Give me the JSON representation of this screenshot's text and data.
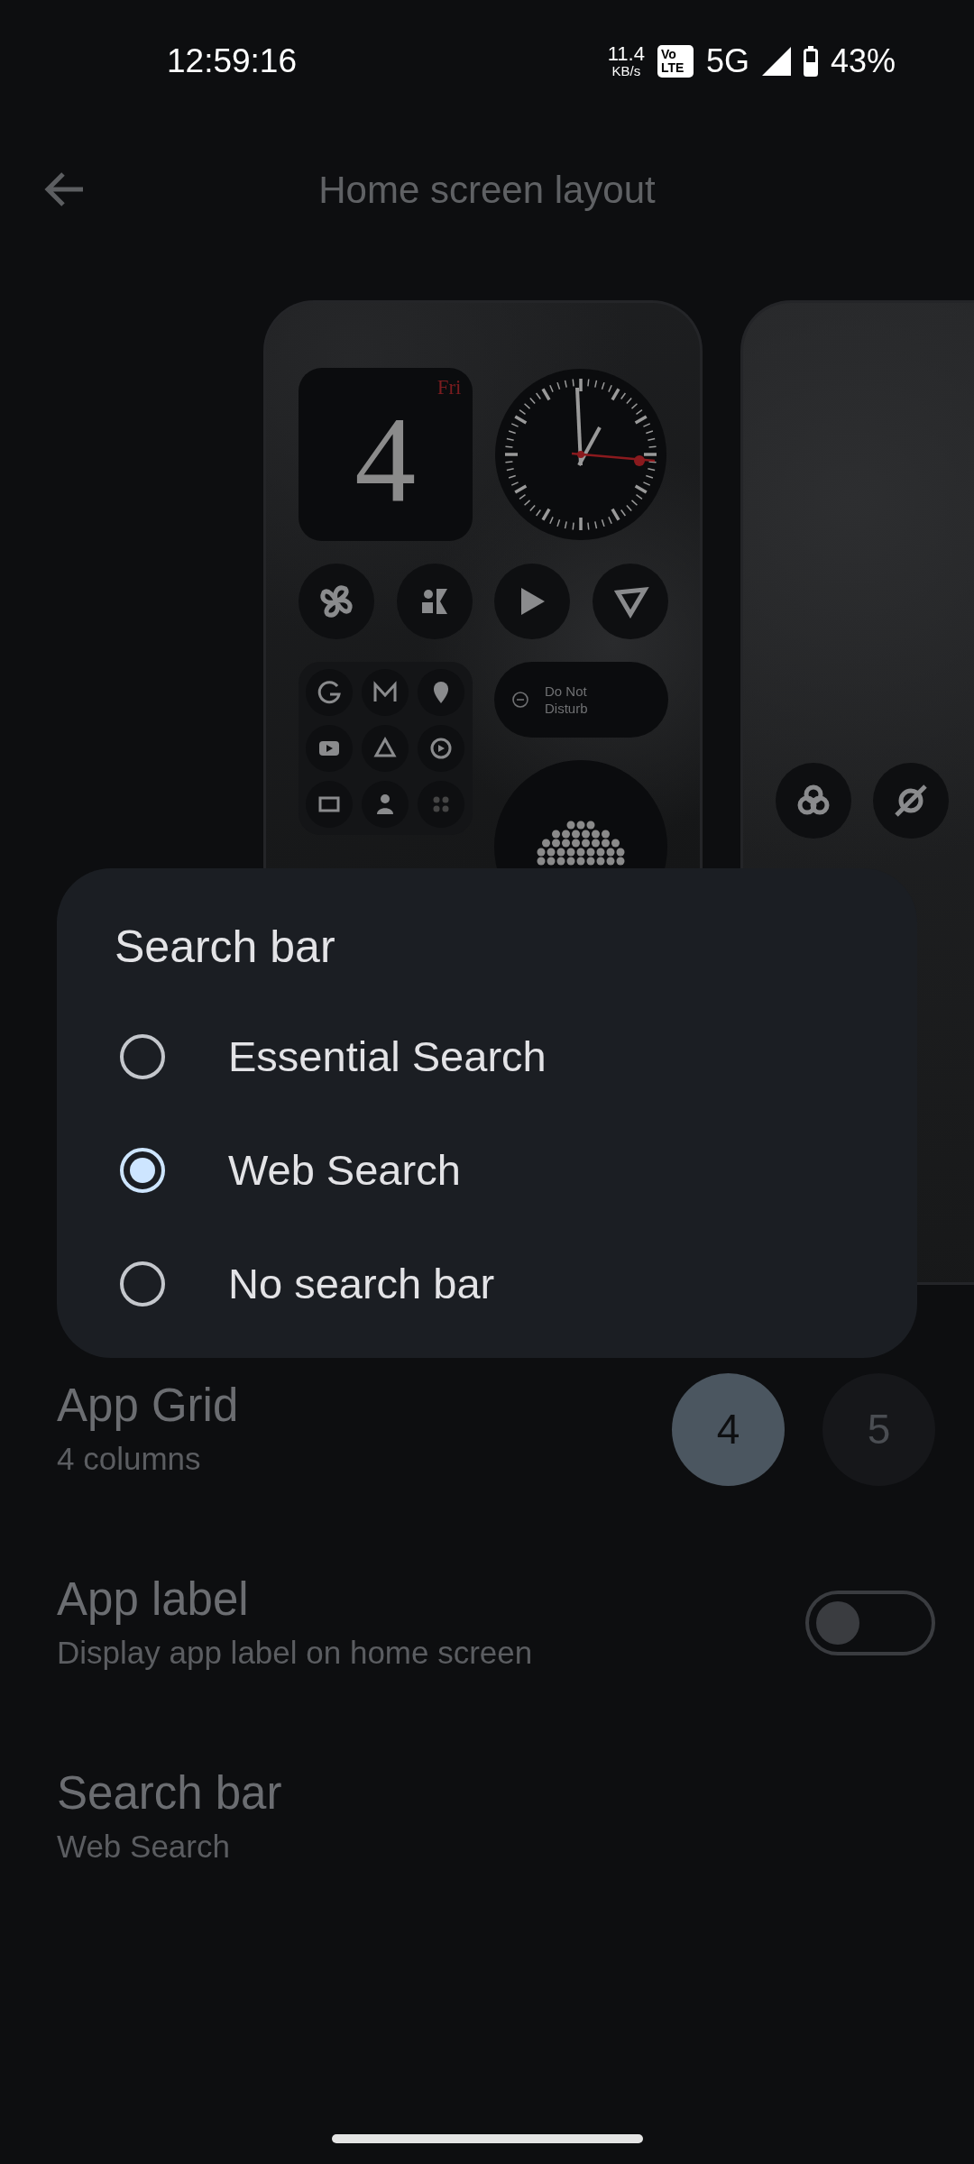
{
  "status_bar": {
    "time": "12:59:16",
    "speed_value": "11.4",
    "speed_unit": "KB/s",
    "volte_top": "Vo",
    "volte_bottom": "LTE",
    "network": "5G",
    "battery": "43%"
  },
  "app_bar": {
    "title": "Home screen layout"
  },
  "preview": {
    "calendar": {
      "day": "Fri",
      "date": "4"
    },
    "dnd_label": "Do Not Disturb"
  },
  "dialog": {
    "title": "Search bar",
    "options": [
      {
        "label": "Essential Search",
        "selected": false
      },
      {
        "label": "Web Search",
        "selected": true
      },
      {
        "label": "No search bar",
        "selected": false
      }
    ]
  },
  "settings": [
    {
      "kind": "grid",
      "title": "App Grid",
      "subtitle": "4 columns",
      "choices": [
        {
          "label": "4",
          "selected": true
        },
        {
          "label": "5",
          "selected": false
        }
      ]
    },
    {
      "kind": "toggle",
      "title": "App label",
      "subtitle": "Display app label on home screen",
      "on": false
    },
    {
      "kind": "plain",
      "title": "Search bar",
      "subtitle": "Web Search"
    }
  ]
}
